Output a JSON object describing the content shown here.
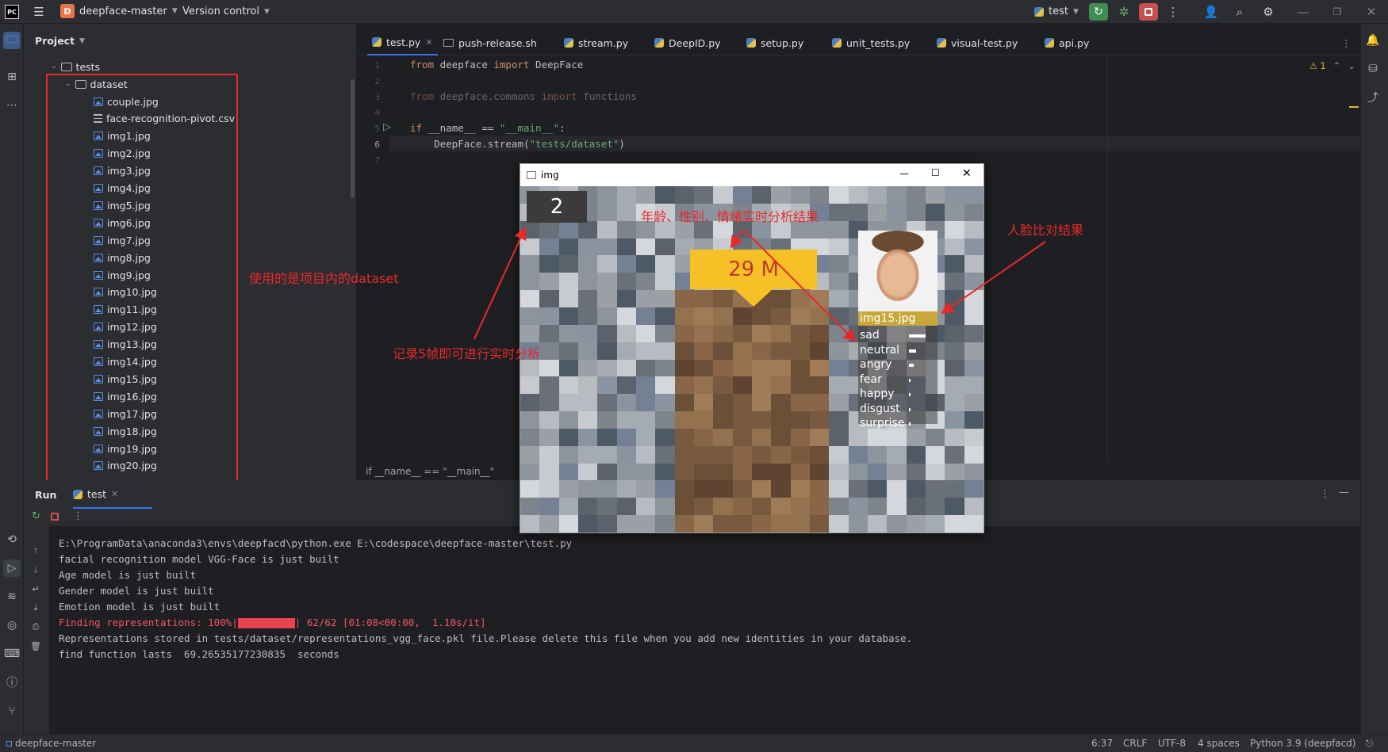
{
  "titlebar": {
    "app_logo": "PC",
    "project_badge": "D",
    "project_name": "deepface-master",
    "vcs_label": "Version control",
    "run_config": "test",
    "icons": [
      "menu-icon",
      "run-icon",
      "debug-icon",
      "stop-icon",
      "more-icon",
      "add-user-icon",
      "search-icon",
      "settings-icon",
      "minimize-icon",
      "restore-icon",
      "close-icon"
    ]
  },
  "project_panel": {
    "title": "Project",
    "root_folder": "tests",
    "dataset_folder": "dataset",
    "files": [
      "couple.jpg",
      "face-recognition-pivot.csv",
      "img1.jpg",
      "img2.jpg",
      "img3.jpg",
      "img4.jpg",
      "img5.jpg",
      "img6.jpg",
      "img7.jpg",
      "img8.jpg",
      "img9.jpg",
      "img10.jpg",
      "img11.jpg",
      "img12.jpg",
      "img13.jpg",
      "img14.jpg",
      "img15.jpg",
      "img16.jpg",
      "img17.jpg",
      "img18.jpg",
      "img19.jpg",
      "img20.jpg"
    ]
  },
  "tabs": [
    {
      "label": "test.py",
      "active": true
    },
    {
      "label": "push-release.sh",
      "active": false
    },
    {
      "label": "stream.py",
      "active": false
    },
    {
      "label": "DeepID.py",
      "active": false
    },
    {
      "label": "setup.py",
      "active": false
    },
    {
      "label": "unit_tests.py",
      "active": false
    },
    {
      "label": "visual-test.py",
      "active": false
    },
    {
      "label": "api.py",
      "active": false
    }
  ],
  "editor": {
    "line_numbers": [
      "1",
      "2",
      "3",
      "4",
      "5",
      "6",
      "7"
    ],
    "line1": {
      "kw1": "from",
      "mod": " deepface ",
      "kw2": "import",
      "name": " DeepFace"
    },
    "line3": {
      "kw1": "from",
      "mod": " deepface.commons ",
      "kw2": "import",
      "name": " functions"
    },
    "line5": {
      "kw": "if",
      "cond": " __name__ == ",
      "str": "\"__main__\"",
      "colon": ":"
    },
    "line6": {
      "call": "    DeepFace.stream(",
      "str": "\"tests/dataset\"",
      "close": ")"
    },
    "warning_count": "1",
    "breadcrumb": "if __name__ == \"__main__\""
  },
  "img_window": {
    "title": "img",
    "frame_counter": "2",
    "age_gender": "29 M",
    "match_label": "img15.jpg",
    "emotions": [
      {
        "label": "sad",
        "value": 0.35
      },
      {
        "label": "neutral",
        "value": 0.15
      },
      {
        "label": "angry",
        "value": 0.1
      },
      {
        "label": "fear",
        "value": 0.04
      },
      {
        "label": "happy",
        "value": 0.04
      },
      {
        "label": "disgust",
        "value": 0.03
      },
      {
        "label": "surprise",
        "value": 0.03
      }
    ]
  },
  "annotations": {
    "dataset_note": "使用的是项目内的dataset",
    "realtime_note": "年龄、性别、情绪实时分析结果",
    "match_note": "人脸比对结果",
    "frames_note": "记录5帧即可进行实时分析"
  },
  "run_panel": {
    "title": "Run",
    "tab": "test",
    "console": {
      "cmd": "E:\\ProgramData\\anaconda3\\envs\\deepfacd\\python.exe E:\\codespace\\deepface-master\\test.py",
      "l2": "facial recognition model VGG-Face is just built",
      "l3": "Age model is just built",
      "l4": "Gender model is just built",
      "l5": "Emotion model is just built",
      "progress_prefix": "Finding representations: 100%|",
      "progress_suffix": "| 62/62 [01:08<00:00,  1.10s/it]",
      "progress_value": 1.0,
      "l7": "Representations stored in tests/dataset/representations_vgg_face.pkl file.Please delete this file when you add new identities in your database.",
      "l8": "find function lasts  69.26535177230835  seconds"
    }
  },
  "statusbar": {
    "project": "deepface-master",
    "position": "6:37",
    "line_sep": "CRLF",
    "encoding": "UTF-8",
    "indent": "4 spaces",
    "interpreter": "Python 3.9 (deepfacd)"
  }
}
